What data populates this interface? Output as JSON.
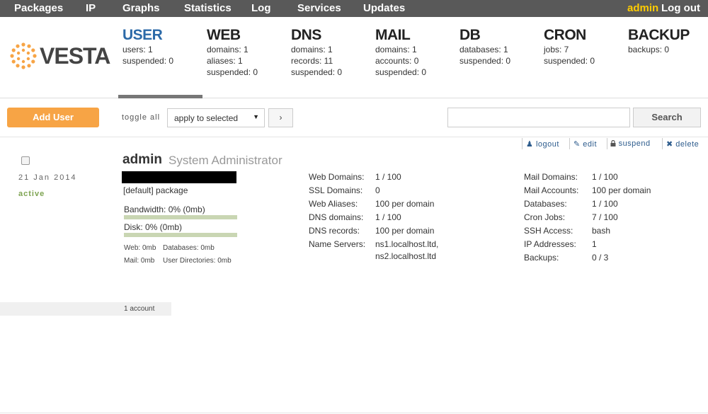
{
  "nav": {
    "items": [
      "Packages",
      "IP",
      "Graphs",
      "Statistics",
      "Log",
      "Services",
      "Updates"
    ],
    "user": "admin",
    "logout": "Log out"
  },
  "logo": {
    "text": "VESTA",
    "color": "#f7a445"
  },
  "tabs": [
    {
      "title": "USER",
      "stats": [
        "users: 1",
        "suspended: 0"
      ]
    },
    {
      "title": "WEB",
      "stats": [
        "domains: 1",
        "aliases: 1",
        "suspended: 0"
      ]
    },
    {
      "title": "DNS",
      "stats": [
        "domains: 1",
        "records: 11",
        "suspended: 0"
      ]
    },
    {
      "title": "MAIL",
      "stats": [
        "domains: 1",
        "accounts: 0",
        "suspended: 0"
      ]
    },
    {
      "title": "DB",
      "stats": [
        "databases: 1",
        "suspended: 0"
      ]
    },
    {
      "title": "CRON",
      "stats": [
        "jobs: 7",
        "suspended: 0"
      ]
    },
    {
      "title": "BACKUP",
      "stats": [
        "backups: 0"
      ]
    }
  ],
  "toolbar": {
    "add_label": "Add User",
    "toggle_all": "toggle all",
    "select_value": "apply to selected",
    "apply_label": "›",
    "search_placeholder": "",
    "search_label": "Search"
  },
  "row_actions": [
    "logout",
    "edit",
    "suspend",
    "delete"
  ],
  "user": {
    "date": "21 Jan 2014",
    "status": "active",
    "username": "admin",
    "fullname": "System Administrator",
    "package": "[default] package",
    "bandwidth": "Bandwidth: 0% (0mb)",
    "bandwidth_used": 0,
    "disk": "Disk: 0% (0mb)",
    "disk_used": 0,
    "usage_web": "Web: 0mb",
    "usage_db": "Databases: 0mb",
    "usage_mail": "Mail: 0mb",
    "usage_dirs": "User Directories: 0mb"
  },
  "stats_mid": [
    {
      "key": "Web Domains:",
      "val": "1 / 100"
    },
    {
      "key": "SSL Domains:",
      "val": "0"
    },
    {
      "key": "Web Aliases:",
      "val": "100 per domain"
    },
    {
      "key": "DNS domains:",
      "val": "1 / 100"
    },
    {
      "key": "DNS records:",
      "val": "100 per domain"
    },
    {
      "key": "Name Servers:",
      "val": "ns1.localhost.ltd,"
    }
  ],
  "name_server_2": "ns2.localhost.ltd",
  "stats_right": [
    {
      "key": "Mail Domains:",
      "val": "1 / 100"
    },
    {
      "key": "Mail Accounts:",
      "val": "100 per domain"
    },
    {
      "key": "Databases:",
      "val": "1 / 100"
    },
    {
      "key": "Cron Jobs:",
      "val": "7 / 100"
    },
    {
      "key": "SSH Access:",
      "val": "bash"
    },
    {
      "key": "IP Addresses:",
      "val": "1"
    },
    {
      "key": "Backups:",
      "val": "0 / 3"
    }
  ],
  "footer": {
    "count": "1 account"
  }
}
